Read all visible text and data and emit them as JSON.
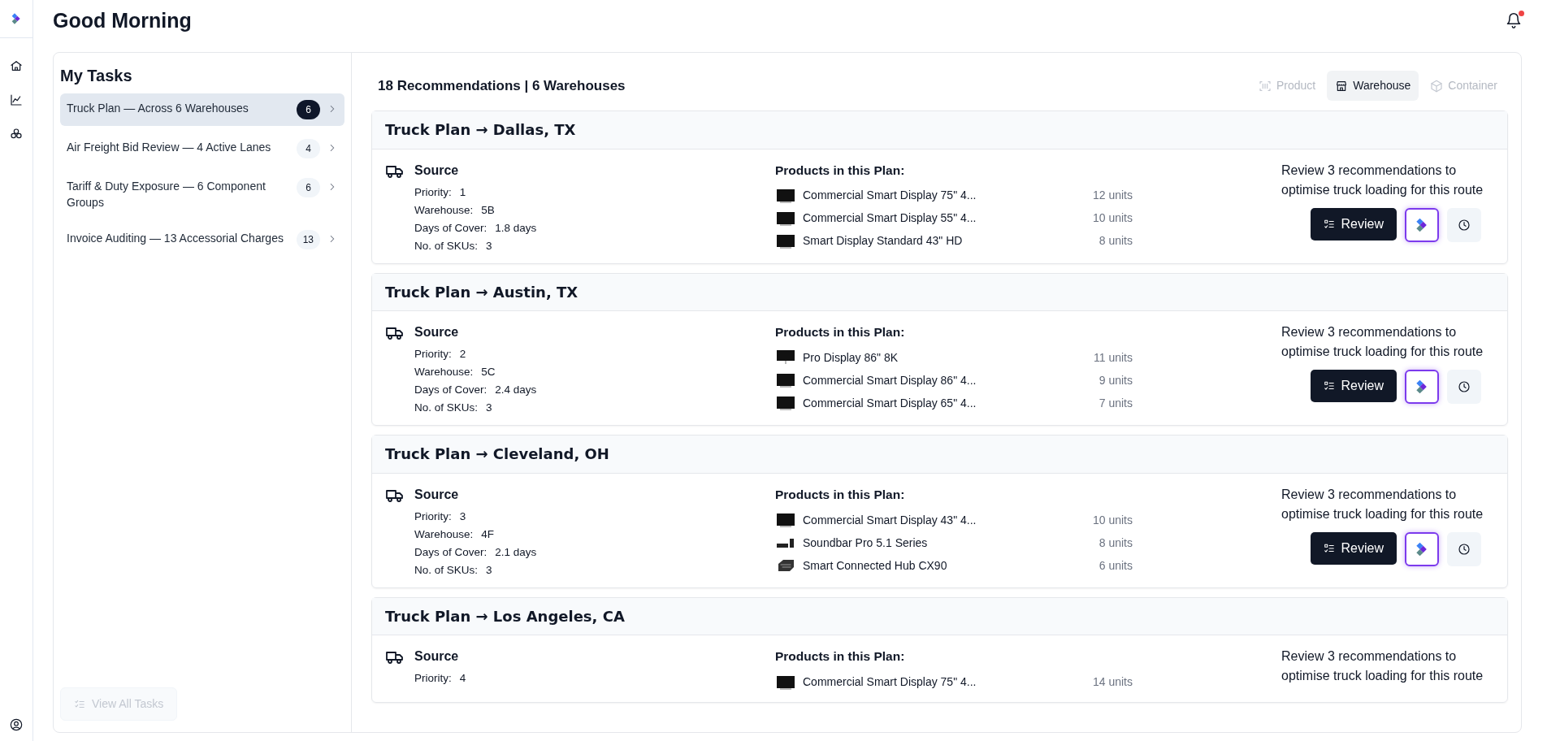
{
  "header": {
    "title": "Good Morning",
    "notifications": {
      "unread": true
    }
  },
  "tasks": {
    "title": "My Tasks",
    "items": [
      {
        "label": "Truck Plan — Across 6 Warehouses",
        "count": "6",
        "selected": true
      },
      {
        "label": "Air Freight Bid Review — 4 Active Lanes",
        "count": "4",
        "selected": false
      },
      {
        "label": "Tariff & Duty Exposure — 6 Component Groups",
        "count": "6",
        "selected": false
      },
      {
        "label": "Invoice Auditing — 13 Accessorial Charges",
        "count": "13",
        "selected": false
      }
    ],
    "view_all": {
      "label": "View All Tasks",
      "disabled": true
    }
  },
  "recommendations": {
    "summary": "18 Recommendations | 6 Warehouses",
    "views": [
      {
        "label": "Product",
        "selected": false
      },
      {
        "label": "Warehouse",
        "selected": true
      },
      {
        "label": "Container",
        "selected": false
      }
    ],
    "plans": [
      {
        "title": "Truck Plan → Dallas, TX",
        "source": "Source",
        "fields": [
          {
            "label": "Priority:",
            "value": "1"
          },
          {
            "label": "Warehouse:",
            "value": "5B"
          },
          {
            "label": "Days of Cover:",
            "value": "1.8 days"
          },
          {
            "label": "No. of SKUs:",
            "value": "3"
          }
        ],
        "products_heading": "Products in this Plan:",
        "products": [
          {
            "kind": "display",
            "name": "Commercial Smart Display 75\" 4...",
            "units": "12 units"
          },
          {
            "kind": "display",
            "name": "Commercial Smart Display 55\" 4...",
            "units": "10 units"
          },
          {
            "kind": "display",
            "name": "Smart Display Standard 43\" HD",
            "units": "8 units"
          }
        ],
        "review_text": "Review 3 recommendations to optimise truck loading for this route",
        "review_button": "Review"
      },
      {
        "title": "Truck Plan → Austin, TX",
        "source": "Source",
        "fields": [
          {
            "label": "Priority:",
            "value": "2"
          },
          {
            "label": "Warehouse:",
            "value": "5C"
          },
          {
            "label": "Days of Cover:",
            "value": "2.4 days"
          },
          {
            "label": "No. of SKUs:",
            "value": "3"
          }
        ],
        "products_heading": "Products in this Plan:",
        "products": [
          {
            "kind": "monitor",
            "name": "Pro Display 86\" 8K",
            "units": "11 units"
          },
          {
            "kind": "display",
            "name": "Commercial Smart Display 86\" 4...",
            "units": "9 units"
          },
          {
            "kind": "display",
            "name": "Commercial Smart Display 65\" 4...",
            "units": "7 units"
          }
        ],
        "review_text": "Review 3 recommendations to optimise truck loading for this route",
        "review_button": "Review"
      },
      {
        "title": "Truck Plan → Cleveland, OH",
        "source": "Source",
        "fields": [
          {
            "label": "Priority:",
            "value": "3"
          },
          {
            "label": "Warehouse:",
            "value": "4F"
          },
          {
            "label": "Days of Cover:",
            "value": "2.1 days"
          },
          {
            "label": "No. of SKUs:",
            "value": "3"
          }
        ],
        "products_heading": "Products in this Plan:",
        "products": [
          {
            "kind": "display",
            "name": "Commercial Smart Display 43\" 4...",
            "units": "10 units"
          },
          {
            "kind": "soundbar",
            "name": "Soundbar Pro 5.1 Series",
            "units": "8 units"
          },
          {
            "kind": "hub",
            "name": "Smart Connected Hub CX90",
            "units": "6 units"
          }
        ],
        "review_text": "Review 3 recommendations to optimise truck loading for this route",
        "review_button": "Review"
      },
      {
        "title": "Truck Plan → Los Angeles, CA",
        "source": "Source",
        "fields": [
          {
            "label": "Priority:",
            "value": "4"
          }
        ],
        "products_heading": "Products in this Plan:",
        "products": [
          {
            "kind": "display",
            "name": "Commercial Smart Display 75\" 4...",
            "units": "14 units"
          }
        ],
        "review_text": "Review 3 recommendations to optimise truck loading for this route"
      }
    ]
  }
}
